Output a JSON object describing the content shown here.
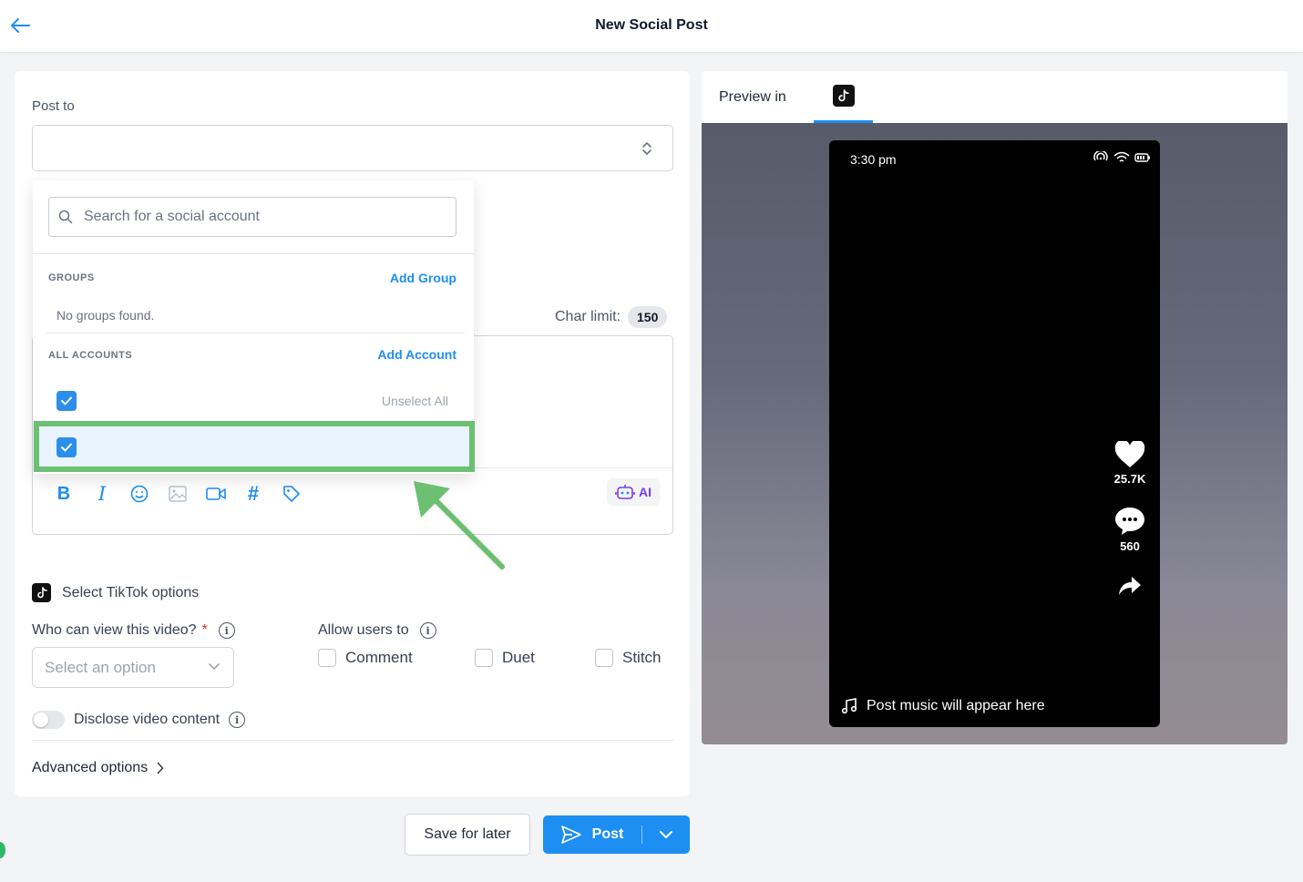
{
  "header": {
    "title": "New Social Post",
    "back_icon": "arrow-left-icon"
  },
  "compose": {
    "post_to_label": "Post to",
    "char_limit_label": "Char limit:",
    "char_limit_value": "150",
    "toolbar": {
      "bold": "B",
      "italic": "I",
      "ai_label": "AI"
    }
  },
  "dropdown": {
    "search_placeholder": "Search for a social account",
    "groups_heading": "GROUPS",
    "add_group": "Add Group",
    "no_groups": "No groups found.",
    "accounts_heading": "ALL ACCOUNTS",
    "add_account": "Add Account",
    "unselect_all": "Unselect All"
  },
  "tiktok": {
    "section_label": "Select TikTok options",
    "who_can_view_label": "Who can view this video?",
    "required_mark": "*",
    "view_placeholder": "Select an option",
    "allow_users_label": "Allow users to",
    "allow_options": [
      "Comment",
      "Duet",
      "Stitch"
    ],
    "disclose_label": "Disclose video content",
    "advanced_label": "Advanced options"
  },
  "preview": {
    "label": "Preview in",
    "time": "3:30 pm",
    "likes": "25.7K",
    "comments": "560",
    "music_text": "Post music will appear here"
  },
  "actions": {
    "save_later": "Save for later",
    "post": "Post"
  },
  "colors": {
    "accent": "#1d8ef2",
    "highlight_border": "#6dbf72",
    "checkbox_checked": "#2b8eea"
  }
}
